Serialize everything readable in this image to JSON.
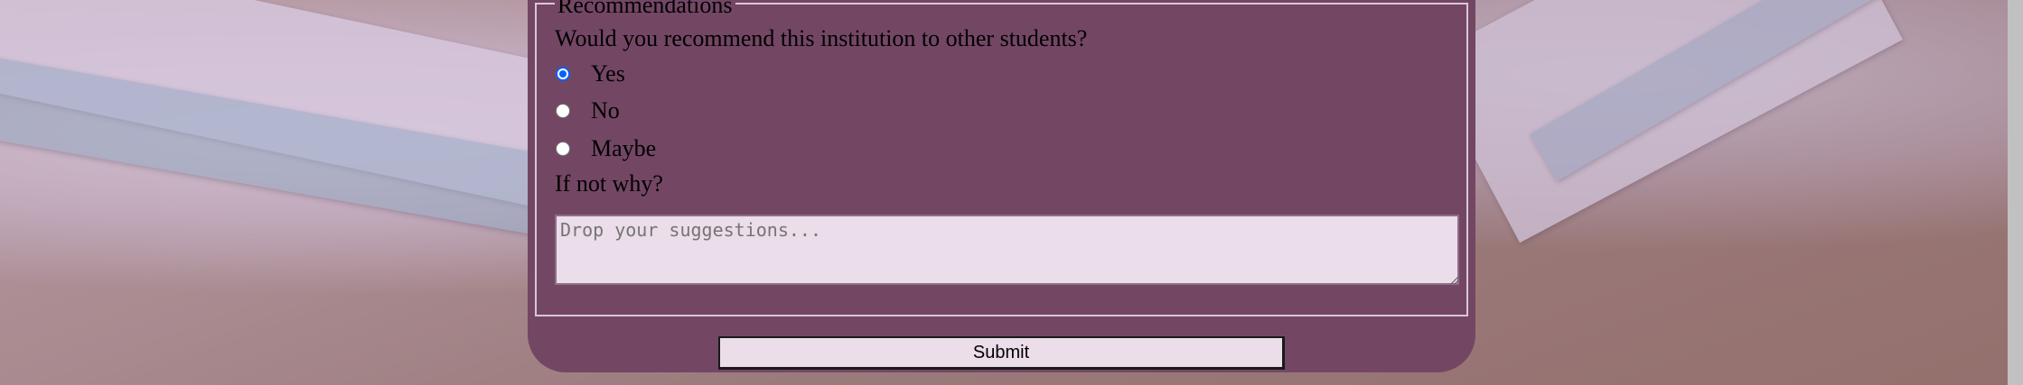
{
  "recommendations": {
    "legend": "Recommendations",
    "question": "Would you recommend this institution to other students?",
    "options": [
      {
        "label": "Yes",
        "checked": true
      },
      {
        "label": "No",
        "checked": false
      },
      {
        "label": "Maybe",
        "checked": false
      }
    ],
    "followup_label": "If not why?",
    "textarea": {
      "placeholder": "Drop your suggestions...",
      "value": ""
    }
  },
  "submit": {
    "label": "Submit"
  },
  "colors": {
    "panel": "#734764",
    "field_background": "#ebdde9",
    "radio_accent": "#0b5fff",
    "fieldset_border": "#d9c7d5"
  }
}
